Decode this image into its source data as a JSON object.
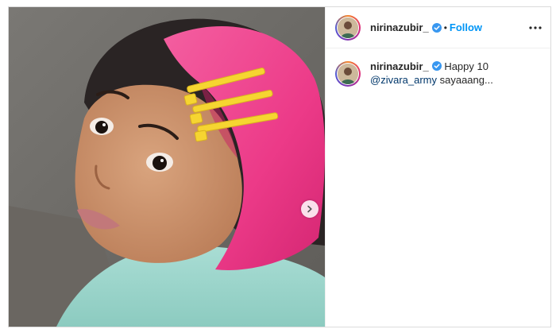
{
  "post": {
    "username": "nirinazubir_",
    "follow_label": "Follow",
    "separator": "•",
    "caption": {
      "username": "nirinazubir_",
      "text_start": "Happy 10",
      "mention": "@zivara_army",
      "text_end": " sayaaang..."
    }
  },
  "icons": {
    "verified": "verified-badge-icon",
    "more": "more-options-icon",
    "next": "chevron-right-icon"
  },
  "colors": {
    "accent": "#0095f6",
    "verified": "#3897f0",
    "mention": "#00376b",
    "hair_pink": "#ee3f8c",
    "clip_yellow": "#f6d531"
  }
}
